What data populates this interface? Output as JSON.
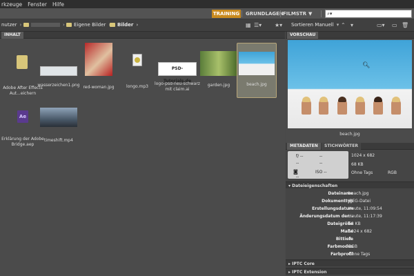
{
  "menubar": {
    "items": [
      "rkzeuge",
      "Fenster",
      "Hilfe"
    ]
  },
  "workspaces": {
    "training": "TRAINING",
    "grundlagen": "GRUNDLAGEN",
    "filmstr": "FILMSTR"
  },
  "search": {
    "placeholder": ""
  },
  "path": {
    "first": "nutzer",
    "second": "Eigene Bilder",
    "third": "Bilder",
    "sort": "Sortieren Manuell"
  },
  "panels": {
    "content": "INHALT",
    "preview": "VORSCHAU",
    "metadata": "METADATEN",
    "keywords": "STICHWÖRTER"
  },
  "items": [
    {
      "label": "Adobe After Effects Aut...eichern",
      "kind": "folder"
    },
    {
      "label": "wasserzeichen1.png",
      "kind": "image"
    },
    {
      "label": "red-woman.jpg",
      "kind": "image"
    },
    {
      "label": "longo.mp3",
      "kind": "audio"
    },
    {
      "label": "logo-psd-neu-schwarz mit claim.ai",
      "kind": "image",
      "logo_text": "PSD-Tutorials.de"
    },
    {
      "label": "garden.jpg",
      "kind": "image"
    },
    {
      "label": "beach.jpg",
      "kind": "image",
      "selected": true
    },
    {
      "label": "Erklärung der Adobe Bridge.aep",
      "kind": "ae"
    },
    {
      "label": "timeshift.mp4",
      "kind": "video"
    }
  ],
  "preview": {
    "caption": "beach.jpg"
  },
  "camera": {
    "f": "f/ --",
    "dash1": "--",
    "dash2": "--",
    "dash3": "--",
    "iso": "ISO --",
    "dash4": "--"
  },
  "quick": {
    "size": "1024 x 682",
    "kb": "68 KB",
    "tags": "Ohne Tags",
    "mode": "RGB"
  },
  "sections": {
    "file": "Dateieigenschaften",
    "iptc_core": "IPTC Core",
    "iptc_ext": "IPTC Extension"
  },
  "file_props": [
    {
      "k": "Dateiname",
      "v": "beach.jpg"
    },
    {
      "k": "Dokumenttyp",
      "v": "JPEG-Datei"
    },
    {
      "k": "Erstellungsdatum",
      "v": "Heute, 11:09:54"
    },
    {
      "k": "Änderungsdatum der...",
      "v": "Heute, 11:17:39"
    },
    {
      "k": "Dateigröße",
      "v": "68 KB"
    },
    {
      "k": "Maße",
      "v": "1024 x 682"
    },
    {
      "k": "Bittiefe",
      "v": "8"
    },
    {
      "k": "Farbmodus",
      "v": "RGB"
    },
    {
      "k": "Farbprofil",
      "v": "Ohne Tags"
    }
  ],
  "colors": {
    "accent": "#c98a1e",
    "folder": "#d8c67a"
  }
}
